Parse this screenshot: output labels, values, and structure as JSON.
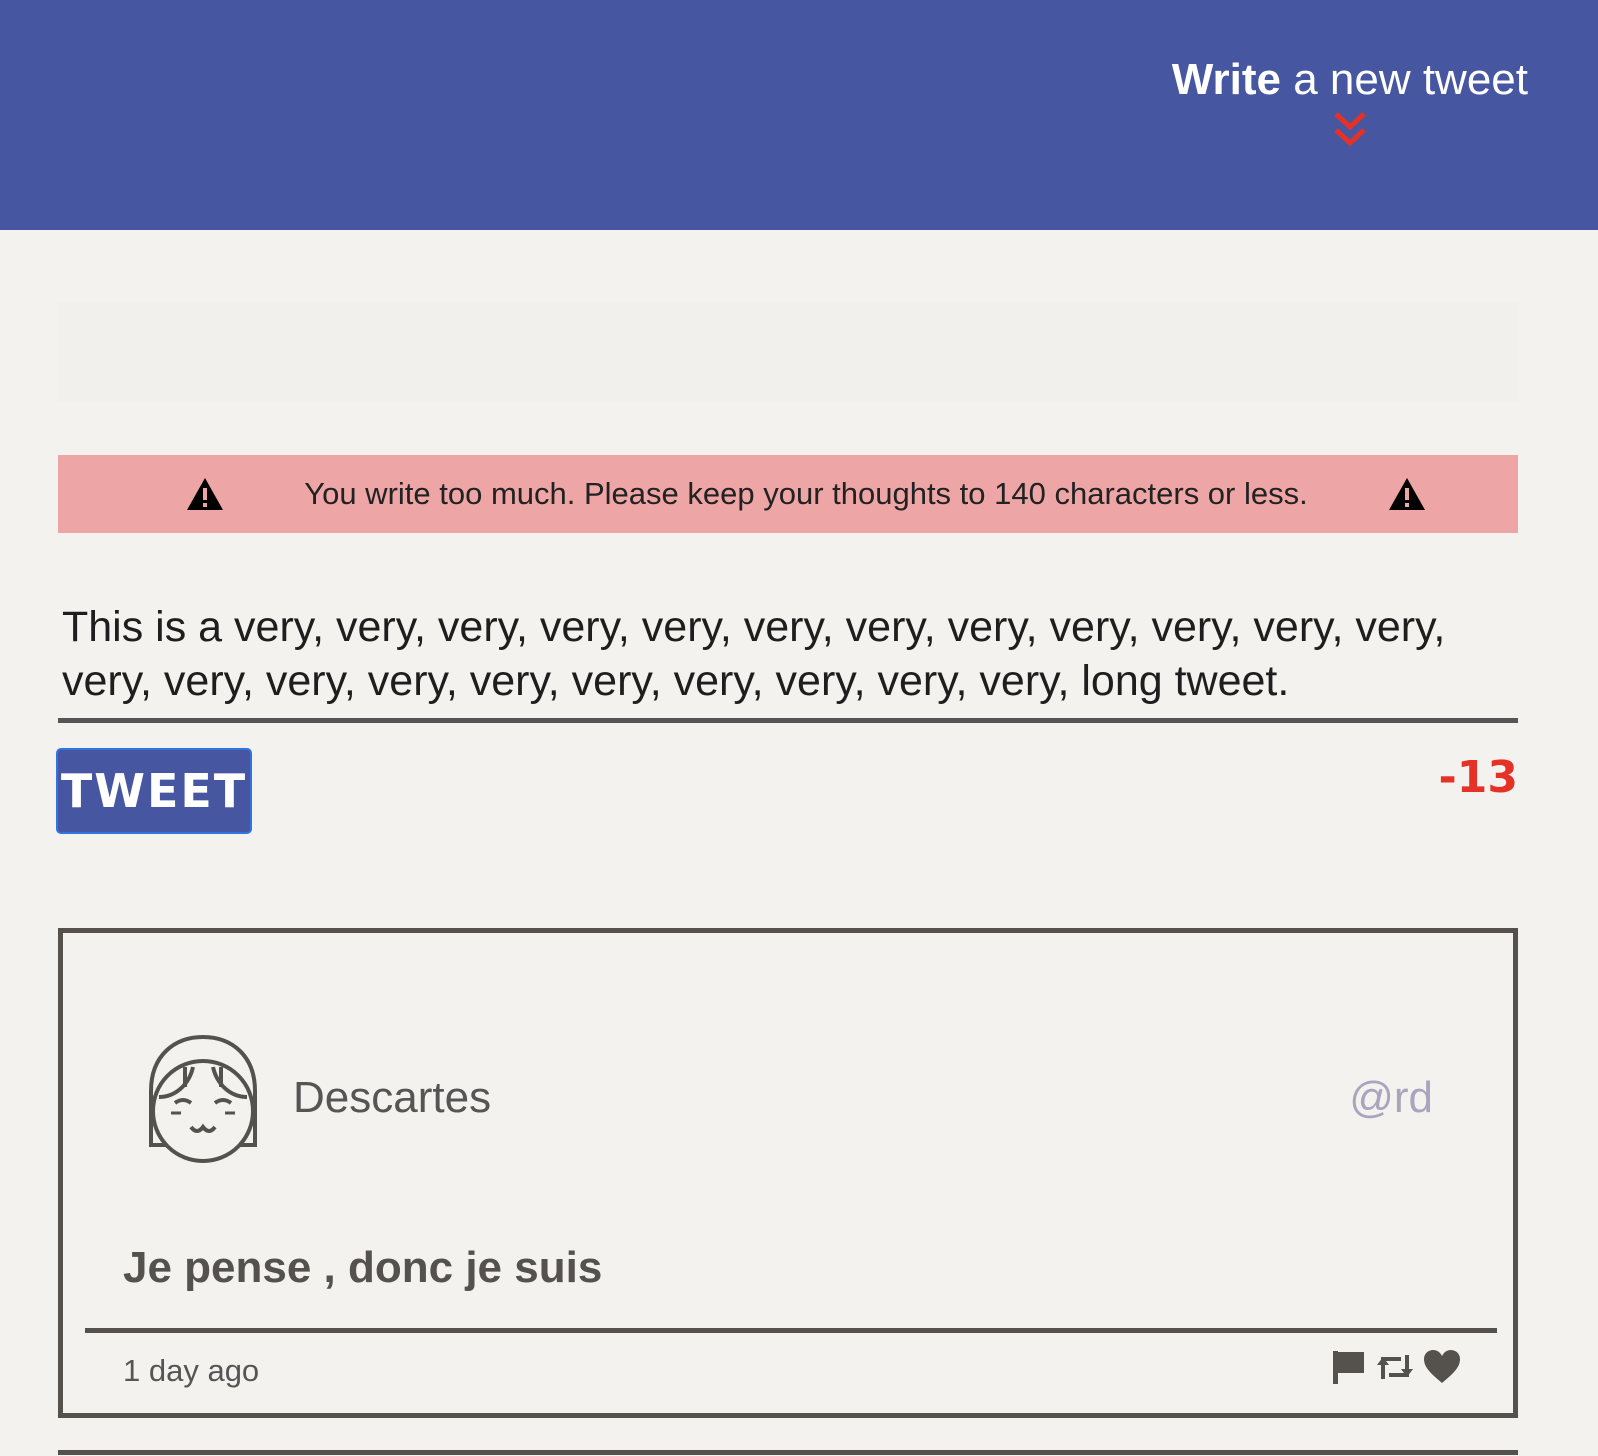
{
  "header": {
    "compose_title_bold": "Write",
    "compose_title_rest": " a new tweet",
    "toggle_icon": "chevron-double-down-icon",
    "colors": {
      "bar": "#4656a0",
      "accent": "#e43326"
    }
  },
  "error": {
    "message": "You write too much. Please keep your thoughts to 140 characters or less.",
    "icon": "warning-icon",
    "color": "#eea5a5"
  },
  "composer": {
    "text": "This is a very, very, very, very, very, very, very, very, very, very, very, very, very, very, very, very, very, very, very, very, very, very, long tweet.",
    "button_label": "TWEET",
    "char_count": "-13"
  },
  "tweets": [
    {
      "name": "Descartes",
      "handle": "@rd",
      "content": "Je pense , donc je suis",
      "time": "1 day ago",
      "avatar_icon": "avatar-face-icon",
      "actions": [
        "flag-icon",
        "retweet-icon",
        "heart-icon"
      ]
    }
  ]
}
